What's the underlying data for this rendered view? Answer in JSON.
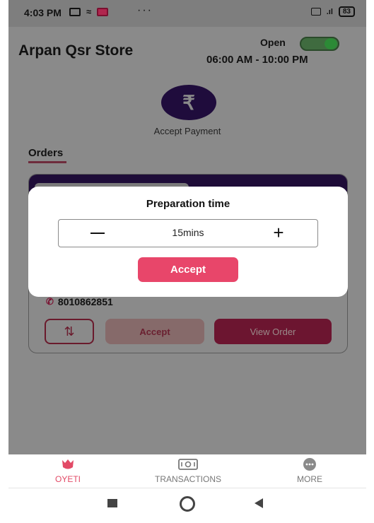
{
  "status_bar": {
    "time": "4:03 PM",
    "dots": "···",
    "battery": "83"
  },
  "store": {
    "name": "Arpan Qsr Store",
    "open_label": "Open",
    "hours": "06:00 AM - 10:00 PM",
    "open": true
  },
  "accept_payment": {
    "label": "Accept Payment",
    "icon": "rupee-icon",
    "glyph": "₹"
  },
  "orders": {
    "tab_label": "Orders",
    "card": {
      "phone": "8010862851",
      "accept_label": "Accept",
      "view_order_label": "View Order"
    }
  },
  "dialog": {
    "title": "Preparation time",
    "minus": "−",
    "value": "15mins",
    "plus": "+",
    "accept_label": "Accept"
  },
  "bottom_nav": {
    "items": [
      {
        "label": "OYETI",
        "icon": "oyeti-icon",
        "active": true
      },
      {
        "label": "TRANSACTIONS",
        "icon": "cash-icon",
        "active": false
      },
      {
        "label": "MORE",
        "icon": "more-icon",
        "active": false
      }
    ]
  },
  "colors": {
    "accent": "#e8466a",
    "brand_dark": "#1e0c38",
    "toggle_on": "#2c8a36"
  }
}
